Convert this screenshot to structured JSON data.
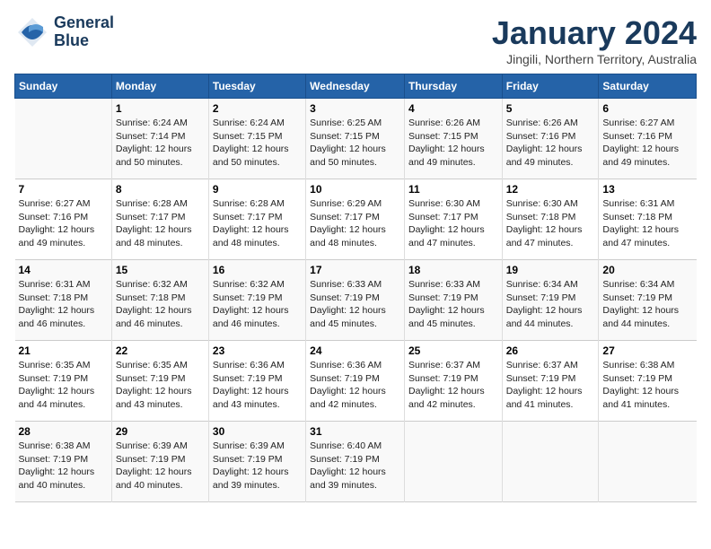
{
  "header": {
    "logo_line1": "General",
    "logo_line2": "Blue",
    "month_title": "January 2024",
    "location": "Jingili, Northern Territory, Australia"
  },
  "days_of_week": [
    "Sunday",
    "Monday",
    "Tuesday",
    "Wednesday",
    "Thursday",
    "Friday",
    "Saturday"
  ],
  "weeks": [
    [
      {
        "day": "",
        "info": ""
      },
      {
        "day": "1",
        "info": "Sunrise: 6:24 AM\nSunset: 7:14 PM\nDaylight: 12 hours\nand 50 minutes."
      },
      {
        "day": "2",
        "info": "Sunrise: 6:24 AM\nSunset: 7:15 PM\nDaylight: 12 hours\nand 50 minutes."
      },
      {
        "day": "3",
        "info": "Sunrise: 6:25 AM\nSunset: 7:15 PM\nDaylight: 12 hours\nand 50 minutes."
      },
      {
        "day": "4",
        "info": "Sunrise: 6:26 AM\nSunset: 7:15 PM\nDaylight: 12 hours\nand 49 minutes."
      },
      {
        "day": "5",
        "info": "Sunrise: 6:26 AM\nSunset: 7:16 PM\nDaylight: 12 hours\nand 49 minutes."
      },
      {
        "day": "6",
        "info": "Sunrise: 6:27 AM\nSunset: 7:16 PM\nDaylight: 12 hours\nand 49 minutes."
      }
    ],
    [
      {
        "day": "7",
        "info": "Sunrise: 6:27 AM\nSunset: 7:16 PM\nDaylight: 12 hours\nand 49 minutes."
      },
      {
        "day": "8",
        "info": "Sunrise: 6:28 AM\nSunset: 7:17 PM\nDaylight: 12 hours\nand 48 minutes."
      },
      {
        "day": "9",
        "info": "Sunrise: 6:28 AM\nSunset: 7:17 PM\nDaylight: 12 hours\nand 48 minutes."
      },
      {
        "day": "10",
        "info": "Sunrise: 6:29 AM\nSunset: 7:17 PM\nDaylight: 12 hours\nand 48 minutes."
      },
      {
        "day": "11",
        "info": "Sunrise: 6:30 AM\nSunset: 7:17 PM\nDaylight: 12 hours\nand 47 minutes."
      },
      {
        "day": "12",
        "info": "Sunrise: 6:30 AM\nSunset: 7:18 PM\nDaylight: 12 hours\nand 47 minutes."
      },
      {
        "day": "13",
        "info": "Sunrise: 6:31 AM\nSunset: 7:18 PM\nDaylight: 12 hours\nand 47 minutes."
      }
    ],
    [
      {
        "day": "14",
        "info": "Sunrise: 6:31 AM\nSunset: 7:18 PM\nDaylight: 12 hours\nand 46 minutes."
      },
      {
        "day": "15",
        "info": "Sunrise: 6:32 AM\nSunset: 7:18 PM\nDaylight: 12 hours\nand 46 minutes."
      },
      {
        "day": "16",
        "info": "Sunrise: 6:32 AM\nSunset: 7:19 PM\nDaylight: 12 hours\nand 46 minutes."
      },
      {
        "day": "17",
        "info": "Sunrise: 6:33 AM\nSunset: 7:19 PM\nDaylight: 12 hours\nand 45 minutes."
      },
      {
        "day": "18",
        "info": "Sunrise: 6:33 AM\nSunset: 7:19 PM\nDaylight: 12 hours\nand 45 minutes."
      },
      {
        "day": "19",
        "info": "Sunrise: 6:34 AM\nSunset: 7:19 PM\nDaylight: 12 hours\nand 44 minutes."
      },
      {
        "day": "20",
        "info": "Sunrise: 6:34 AM\nSunset: 7:19 PM\nDaylight: 12 hours\nand 44 minutes."
      }
    ],
    [
      {
        "day": "21",
        "info": "Sunrise: 6:35 AM\nSunset: 7:19 PM\nDaylight: 12 hours\nand 44 minutes."
      },
      {
        "day": "22",
        "info": "Sunrise: 6:35 AM\nSunset: 7:19 PM\nDaylight: 12 hours\nand 43 minutes."
      },
      {
        "day": "23",
        "info": "Sunrise: 6:36 AM\nSunset: 7:19 PM\nDaylight: 12 hours\nand 43 minutes."
      },
      {
        "day": "24",
        "info": "Sunrise: 6:36 AM\nSunset: 7:19 PM\nDaylight: 12 hours\nand 42 minutes."
      },
      {
        "day": "25",
        "info": "Sunrise: 6:37 AM\nSunset: 7:19 PM\nDaylight: 12 hours\nand 42 minutes."
      },
      {
        "day": "26",
        "info": "Sunrise: 6:37 AM\nSunset: 7:19 PM\nDaylight: 12 hours\nand 41 minutes."
      },
      {
        "day": "27",
        "info": "Sunrise: 6:38 AM\nSunset: 7:19 PM\nDaylight: 12 hours\nand 41 minutes."
      }
    ],
    [
      {
        "day": "28",
        "info": "Sunrise: 6:38 AM\nSunset: 7:19 PM\nDaylight: 12 hours\nand 40 minutes."
      },
      {
        "day": "29",
        "info": "Sunrise: 6:39 AM\nSunset: 7:19 PM\nDaylight: 12 hours\nand 40 minutes."
      },
      {
        "day": "30",
        "info": "Sunrise: 6:39 AM\nSunset: 7:19 PM\nDaylight: 12 hours\nand 39 minutes."
      },
      {
        "day": "31",
        "info": "Sunrise: 6:40 AM\nSunset: 7:19 PM\nDaylight: 12 hours\nand 39 minutes."
      },
      {
        "day": "",
        "info": ""
      },
      {
        "day": "",
        "info": ""
      },
      {
        "day": "",
        "info": ""
      }
    ]
  ]
}
